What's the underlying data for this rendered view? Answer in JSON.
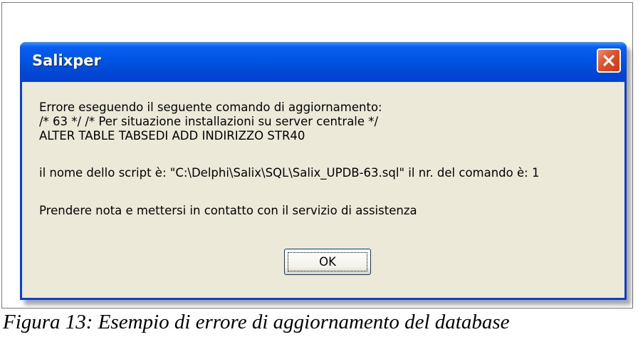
{
  "dialog": {
    "title": "Salixper",
    "close_icon": "close-icon",
    "lines": {
      "line1": "Errore eseguendo il seguente comando di aggiornamento:",
      "line2": "/* 63 */ /* Per situazione installazioni su server centrale */",
      "line3": "ALTER TABLE TABSEDI ADD INDIRIZZO STR40",
      "line4": "il nome dello script è: \"C:\\Delphi\\Salix\\SQL\\Salix_UPDB-63.sql\" il nr. del comando è: 1",
      "line5": "Prendere nota e mettersi in contatto con il servizio di assistenza"
    },
    "ok_label": "OK"
  },
  "caption": "Figura 13: Esempio di errore di aggiornamento del database",
  "colors": {
    "titlebar": "#0054e3",
    "dialog_bg": "#ece9d8",
    "close_button": "#e0502b"
  }
}
